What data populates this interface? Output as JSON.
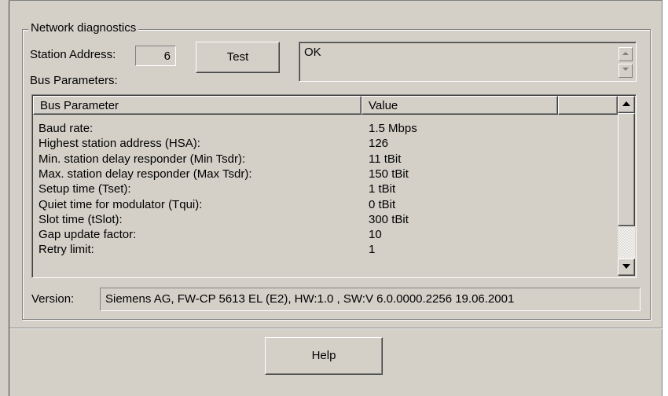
{
  "group": {
    "title": "Network diagnostics"
  },
  "station": {
    "label": "Station Address:",
    "value": "6"
  },
  "buttons": {
    "test": "Test",
    "help": "Help"
  },
  "status": {
    "text": "OK"
  },
  "bus": {
    "label": "Bus Parameters:",
    "columns": [
      "Bus Parameter",
      "Value"
    ],
    "rows": [
      {
        "name": "Baud rate:",
        "value": "1.5 Mbps"
      },
      {
        "name": "Highest station address (HSA):",
        "value": "126"
      },
      {
        "name": "Min. station delay responder (Min Tsdr):",
        "value": "11 tBit"
      },
      {
        "name": "Max. station delay responder (Max Tsdr):",
        "value": "150 tBit"
      },
      {
        "name": "Setup time (Tset):",
        "value": "1 tBit"
      },
      {
        "name": "Quiet time for modulator (Tqui):",
        "value": "0 tBit"
      },
      {
        "name": "Slot time (tSlot):",
        "value": "300 tBit"
      },
      {
        "name": "Gap update factor:",
        "value": "10"
      },
      {
        "name": "Retry limit:",
        "value": "1"
      }
    ]
  },
  "version": {
    "label": "Version:",
    "value": "Siemens AG, FW-CP 5613 EL (E2), HW:1.0 , SW:V 6.0.0000.2256 19.06.2001"
  },
  "colors": {
    "face": "#d4d0c8",
    "shadow": "#808080",
    "highlight": "#ffffff"
  },
  "icons": [
    "up-arrow",
    "down-arrow"
  ]
}
